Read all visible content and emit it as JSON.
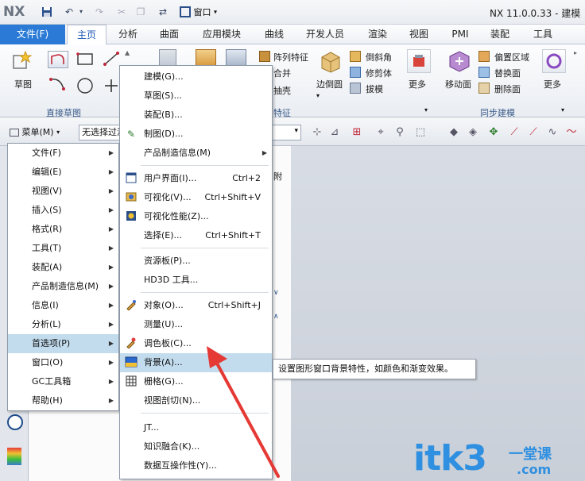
{
  "app": {
    "logo": "NX",
    "window_menu_label": "窗口",
    "title": "NX 11.0.0.33 - 建模"
  },
  "ribbon": {
    "file_tab": "文件(F)",
    "tabs": [
      "主页",
      "分析",
      "曲面",
      "应用模块",
      "曲线",
      "开发人员",
      "渲染",
      "视图",
      "PMI",
      "装配",
      "工具"
    ],
    "active_tab": "主页",
    "sketch_label": "草图",
    "direct_sketch_group": "直接草图",
    "pattern_feature": "阵列特征",
    "unite": "合并",
    "shell": "抽壳",
    "edge_blend": "边倒圆",
    "chamfer": "倒斜角",
    "trim_body": "修剪体",
    "draft": "拔模",
    "more": "更多",
    "feature_group": "特征",
    "move_face": "移动面",
    "offset_region": "偏置区域",
    "replace_face": "替换面",
    "delete_face": "删除面",
    "sync_group": "同步建模"
  },
  "toolbar": {
    "menu_button": "菜单(M)",
    "filter_placeholder": "无选择过滤器"
  },
  "main_menu": {
    "items": [
      {
        "label": "文件(F)",
        "submenu": true
      },
      {
        "label": "编辑(E)",
        "submenu": true
      },
      {
        "label": "视图(V)",
        "submenu": true
      },
      {
        "label": "插入(S)",
        "submenu": true
      },
      {
        "label": "格式(R)",
        "submenu": true
      },
      {
        "label": "工具(T)",
        "submenu": true
      },
      {
        "label": "装配(A)",
        "submenu": true
      },
      {
        "label": "产品制造信息(M)",
        "submenu": true
      },
      {
        "label": "信息(I)",
        "submenu": true
      },
      {
        "label": "分析(L)",
        "submenu": true
      },
      {
        "label": "首选项(P)",
        "submenu": true,
        "highlighted": true
      },
      {
        "label": "窗口(O)",
        "submenu": true
      },
      {
        "label": "GC工具箱",
        "submenu": true
      },
      {
        "label": "帮助(H)",
        "submenu": true
      }
    ]
  },
  "pref_menu": {
    "items": [
      {
        "label": "建模(G)..."
      },
      {
        "label": "草图(S)..."
      },
      {
        "label": "装配(B)..."
      },
      {
        "label": "制图(D)...",
        "icon": "drafting-icon"
      },
      {
        "label": "产品制造信息(M)",
        "submenu": true
      },
      {
        "label": "用户界面(I)...",
        "shortcut": "Ctrl+2",
        "icon": "ui-icon"
      },
      {
        "label": "可视化(V)...",
        "shortcut": "Ctrl+Shift+V",
        "icon": "visualization-icon"
      },
      {
        "label": "可视化性能(Z)...",
        "icon": "performance-icon"
      },
      {
        "label": "选择(E)...",
        "shortcut": "Ctrl+Shift+T"
      },
      {
        "label": "资源板(P)..."
      },
      {
        "label": "HD3D 工具..."
      },
      {
        "label": "对象(O)...",
        "shortcut": "Ctrl+Shift+J",
        "icon": "object-icon"
      },
      {
        "label": "测量(U)..."
      },
      {
        "label": "调色板(C)...",
        "icon": "palette-icon"
      },
      {
        "label": "背景(A)...",
        "icon": "background-icon",
        "highlighted": true
      },
      {
        "label": "栅格(G)...",
        "icon": "grid-icon"
      },
      {
        "label": "视图剖切(N)..."
      },
      {
        "label": "JT..."
      },
      {
        "label": "知识融合(K)..."
      },
      {
        "label": "数据互操作性(Y)..."
      }
    ]
  },
  "tooltip": "设置图形窗口背景特性，如颜色和渐变效果。",
  "nav_panel": {
    "tab_label": "附"
  },
  "watermark": {
    "text": "itk3",
    "cn": "一堂课",
    "domain": ".com"
  },
  "colors": {
    "file_tab": "#2b7bd6",
    "highlight": "#c2dcee",
    "arrow": "#e53935",
    "watermark": "#2f8fe0"
  }
}
